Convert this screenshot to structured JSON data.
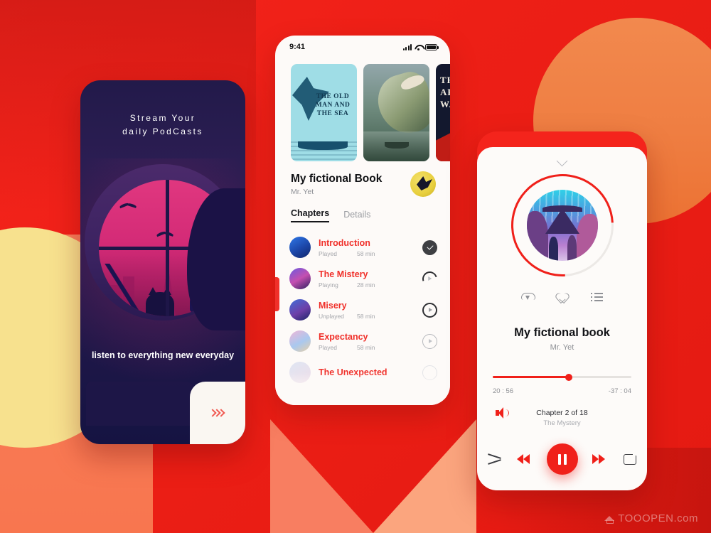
{
  "background": {
    "base_color": "#ee2218",
    "orange_circle_color": "#ef7e42",
    "yellow_circle_color": "#f7e18e",
    "pyramid_left_color": "#f87e61",
    "pyramid_right_color": "#fba57e"
  },
  "onboarding": {
    "headline_line1": "Stream Your",
    "headline_line2": "daily PodCasts",
    "tagline": "listen to everything new everyday",
    "next_label": "next",
    "accent_color": "#f05a52"
  },
  "book_detail": {
    "status_bar": {
      "time": "9:41"
    },
    "covers": [
      {
        "title": "THE OLD MAN AND THE SEA",
        "style": "old-man-sea"
      },
      {
        "title": "",
        "style": "moby-dick"
      },
      {
        "title": "THE ART OF WAR",
        "style": "art-of-war"
      }
    ],
    "title": "My fictional Book",
    "author": "Mr. Yet",
    "tabs": [
      {
        "label": "Chapters",
        "active": true
      },
      {
        "label": "Details",
        "active": false
      }
    ],
    "chapters": [
      {
        "name": "Introduction",
        "status": "Played",
        "duration": "58 min",
        "state": "done"
      },
      {
        "name": "The Mistery",
        "status": "Playing",
        "duration": "28 min",
        "state": "playing"
      },
      {
        "name": "Misery",
        "status": "Unplayed",
        "duration": "58 min",
        "state": "unplayed"
      },
      {
        "name": "Expectancy",
        "status": "Played",
        "duration": "58 min",
        "state": "unplayed-light"
      },
      {
        "name": "The Unexpected",
        "status": "",
        "duration": "",
        "state": "unplayed-faded"
      }
    ],
    "title_color": "#101114",
    "chapter_name_color": "#f0302a"
  },
  "player": {
    "title": "My fictional book",
    "author": "Mr. Yet",
    "elapsed": "20 : 56",
    "remaining": "-37 : 04",
    "progress_percent": 55,
    "chapter_line": "Chapter 2 of  18",
    "chapter_name": "The Mystery",
    "icons": {
      "download": "cloud-download-icon",
      "favorite": "heart-icon",
      "playlist": "list-icon",
      "volume": "volume-icon",
      "collapse": "chevron-down-icon"
    },
    "controls": {
      "shuffle": "shuffle-icon",
      "previous": "rewind-icon",
      "play_pause": "pause-icon",
      "next": "fast-forward-icon",
      "repeat": "repeat-icon"
    },
    "accent_color": "#f0201a"
  },
  "watermark": {
    "text": "TOOOPEN.com"
  }
}
